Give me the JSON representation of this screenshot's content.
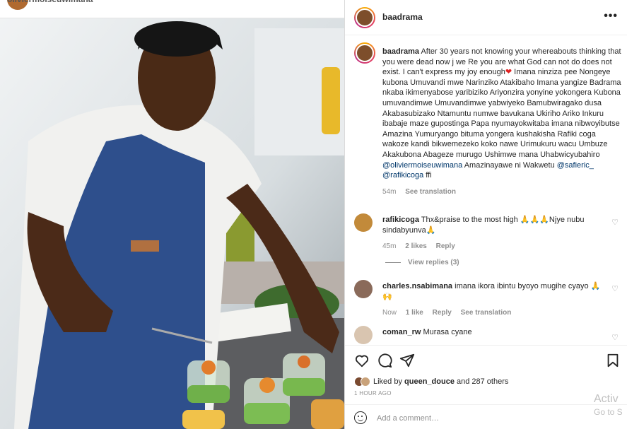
{
  "photo": {
    "top_username": "oliviermoiseuwimana",
    "alt": "photo"
  },
  "post": {
    "username": "baadrama",
    "more": "•••",
    "caption_user": "baadrama",
    "caption_text_1": "After 30 years not knowing your whereabouts thinking that you were dead now j we Re you are what God can not do does not exist. I can't express my joy enough",
    "caption_heart": "❤",
    "caption_text_2": " Imana ninziza pee Nongeye kubona Umuvandi mwe Narinziko Atakibaho Imana yangize Badrama nkaba ikimenyabose yaribiziko Ariyonzira yonyine yokongera Kubona umuvandimwe Umuvandimwe yabwiyeko Bamubwiragako dusa Akabasubizako Ntamuntu numwe bavukana Ukiriho Ariko Inkuru ibabaje maze gupostinga Papa nyumayokwitaba imana nibwoyibutse Amazina Yumuryango bituma yongera kushakisha Rafiki coga wakoze kandi bikwemezeko koko nawe Urimukuru wacu Umbuze Akakubona Abageze murugo Ushimwe mana Uhabwicyubahiro ",
    "mention_1": "@oliviermoiseuwimana",
    "caption_text_3": " Amazinayawe ni Wakwetu ",
    "mention_2": "@safieric_",
    "mention_3": "@rafikicoga",
    "caption_text_4": " ffi",
    "caption_time": "54m",
    "see_translation": "See translation"
  },
  "comments": [
    {
      "user": "rafikicoga",
      "text": "Thx&praise to the most high 🙏🙏🙏Njye nubu sindabyunva🙏",
      "time": "45m",
      "likes": "2 likes",
      "reply": "Reply",
      "avatar_color": "#c28a3a"
    },
    {
      "user": "charles.nsabimana",
      "text": "imana ikora ibintu byoyo mugihe cyayo 🙏🙌",
      "time": "Now",
      "likes": "1 like",
      "reply": "Reply",
      "translate": "See translation",
      "avatar_color": "#8a6a5a"
    },
    {
      "user": "coman_rw",
      "text": "Murasa cyane",
      "avatar_color": "#d9c5b0"
    }
  ],
  "view_replies": "View replies (3)",
  "likes": {
    "prefix": "Liked by ",
    "user": "queen_douce",
    "suffix": " and 287 others"
  },
  "time_ago": "1 HOUR AGO",
  "add_comment": "Add a comment…",
  "watermark": {
    "line1": "Activ",
    "line2": "Go to S"
  }
}
